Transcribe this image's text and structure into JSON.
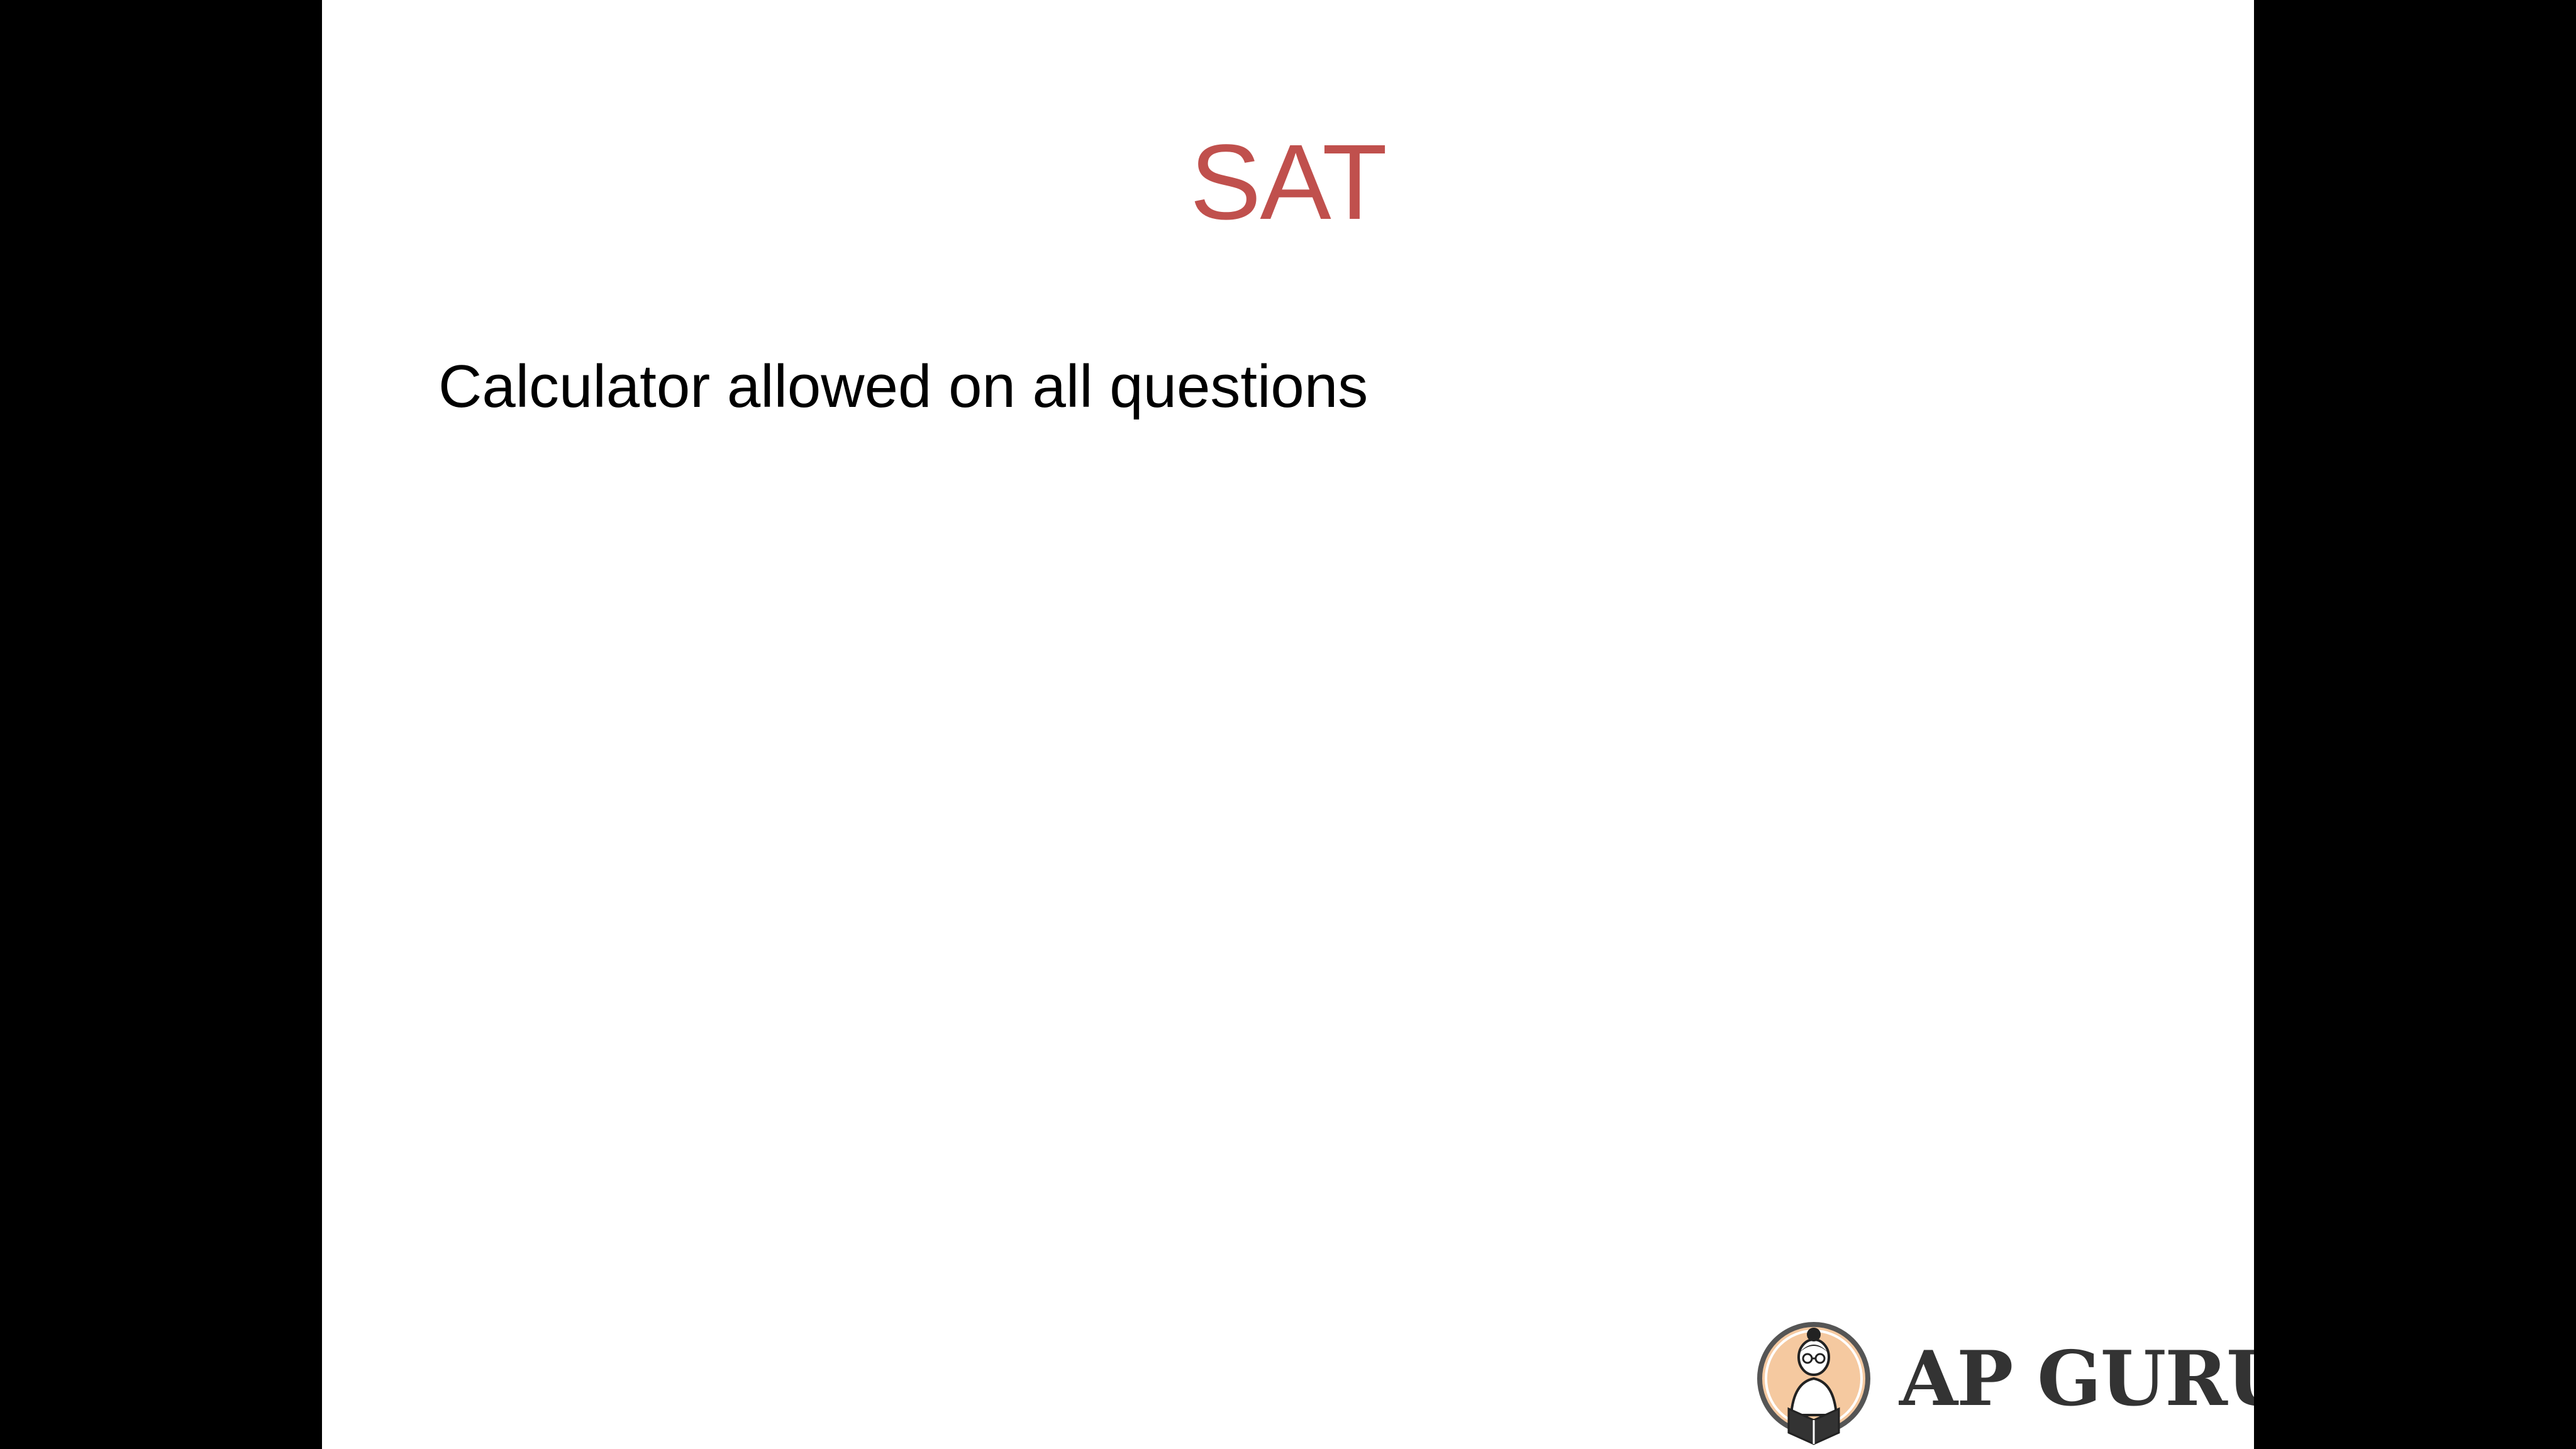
{
  "slide": {
    "title": "SAT",
    "body": "Calculator allowed on all questions",
    "logo_text": "AP GURU"
  },
  "colors": {
    "background": "#000000",
    "slide": "#ffffff",
    "title": "#c0504d",
    "body_text": "#000000",
    "logo_text": "#333333",
    "logo_badge": "#f5c9a0"
  },
  "icons": {
    "logo_badge": "reading-person-icon"
  }
}
